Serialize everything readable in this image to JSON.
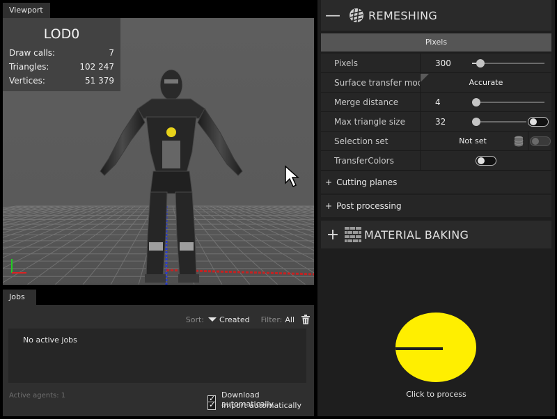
{
  "viewport": {
    "tab_label": "Viewport",
    "stats": {
      "lod": "LOD0",
      "rows": [
        {
          "label": "Draw calls:",
          "value": "7"
        },
        {
          "label": "Triangles:",
          "value": "102 247"
        },
        {
          "label": "Vertices:",
          "value": "51 379"
        }
      ]
    }
  },
  "jobs": {
    "tab_label": "Jobs",
    "sort_label": "Sort:",
    "sort_value": "Created",
    "filter_label": "Filter:",
    "filter_value": "All",
    "empty_text": "No active jobs",
    "agents_text": "Active agents: 1",
    "download_label": "Download automatically",
    "import_label": "Import automatically"
  },
  "remeshing": {
    "title": "REMESHING",
    "collapse_symbol": "—",
    "mode_bar": "Pixels",
    "props": {
      "pixels": {
        "label": "Pixels",
        "value": "300"
      },
      "transfer_mode": {
        "label": "Surface transfer mode",
        "value": "Accurate"
      },
      "merge": {
        "label": "Merge distance",
        "value": "4"
      },
      "max_tri": {
        "label": "Max triangle size",
        "value": "32"
      },
      "selection": {
        "label": "Selection set",
        "value": "Not set"
      },
      "transfer_colors": {
        "label": "TransferColors"
      }
    },
    "cutting_planes": "Cutting planes",
    "post_processing": "Post processing",
    "expand_symbol": "+"
  },
  "material_baking": {
    "title": "MATERIAL BAKING",
    "expand_symbol": "+"
  },
  "process": {
    "label": "Click to process",
    "color": "#ffef00"
  },
  "icons": [
    "remeshing-icon",
    "material-baking-icon",
    "trash-icon",
    "database-icon",
    "cursor-icon",
    "axes-icon"
  ]
}
